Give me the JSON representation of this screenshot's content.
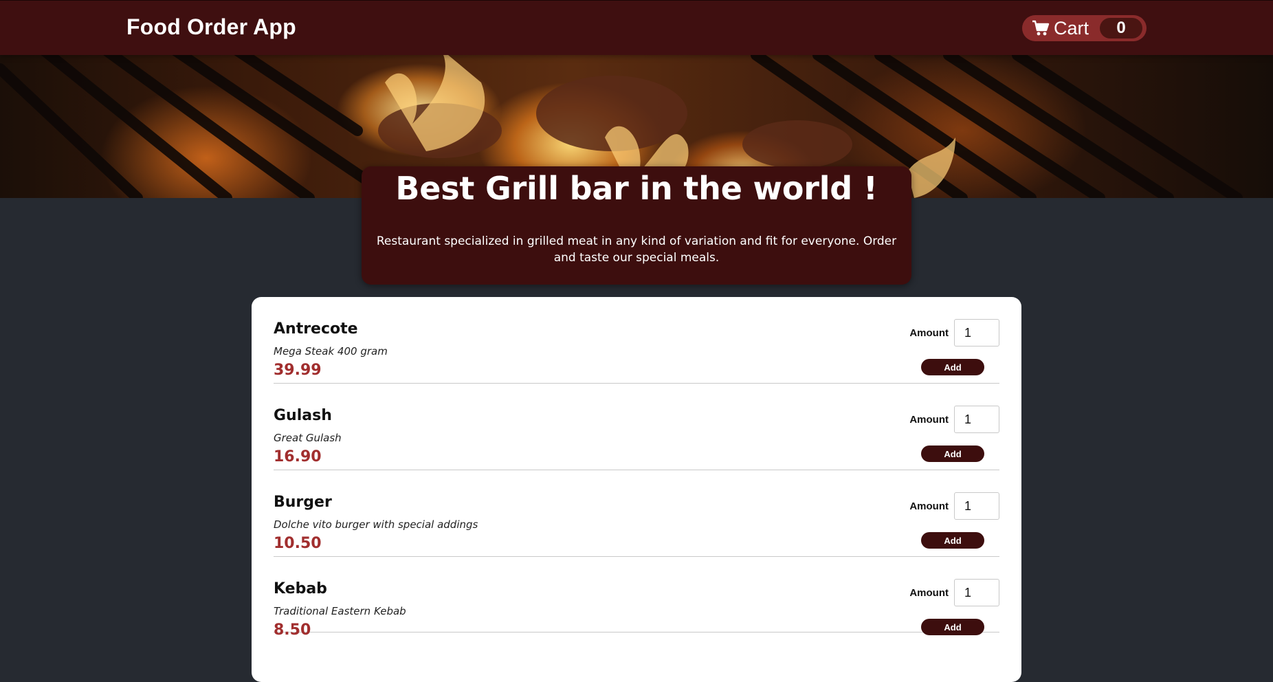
{
  "header": {
    "title": "Food Order App",
    "cart_label": "Cart",
    "cart_count": "0",
    "cart_icon": "shopping-cart-icon"
  },
  "hero": {
    "image": "grilled-meat-on-flaming-grill",
    "title": "Best Grill bar in the world !",
    "description": "Restaurant specialized in grilled meat in any kind of variation and fit for everyone. Order and taste our special meals."
  },
  "menu": {
    "amount_label": "Amount",
    "add_label": "Add",
    "items": [
      {
        "name": "Antrecote",
        "description": "Mega Steak 400 gram",
        "price": "39.99",
        "amount": "1"
      },
      {
        "name": "Gulash",
        "description": "Great Gulash",
        "price": "16.90",
        "amount": "1"
      },
      {
        "name": "Burger",
        "description": "Dolche vito burger with special addings",
        "price": "10.50",
        "amount": "1"
      },
      {
        "name": "Kebab",
        "description": "Traditional Eastern Kebab",
        "price": "8.50",
        "amount": "1"
      }
    ]
  },
  "colors": {
    "header_bg": "#3f0f10",
    "cart_button_bg": "#8a2b2b",
    "cart_badge_bg": "#4a1512",
    "page_bg": "#262a31",
    "price_color": "#a12e2e",
    "add_button_bg": "#3d0e0e"
  }
}
